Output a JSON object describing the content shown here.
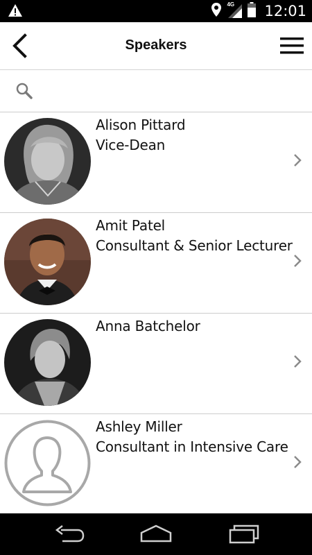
{
  "status_bar": {
    "time": "12:01",
    "network": "4G",
    "icons": [
      "warning-icon",
      "location-icon",
      "signal-icon",
      "battery-icon"
    ]
  },
  "header": {
    "title": "Speakers",
    "back_icon": "chevron-left-icon",
    "menu_icon": "hamburger-menu-icon"
  },
  "search": {
    "placeholder": "",
    "value": "",
    "icon": "search-icon"
  },
  "speakers": [
    {
      "name": "Alison Pittard",
      "role": "Vice-Dean",
      "avatar": "photo"
    },
    {
      "name": "Amit Patel",
      "role": "Consultant & Senior Lecturer",
      "avatar": "photo"
    },
    {
      "name": "Anna Batchelor",
      "role": "",
      "avatar": "photo"
    },
    {
      "name": "Ashley Miller",
      "role": "Consultant in Intensive Care",
      "avatar": "placeholder-silhouette"
    }
  ],
  "nav_bar": {
    "buttons": [
      "back-nav-icon",
      "home-nav-icon",
      "recents-nav-icon"
    ]
  },
  "colors": {
    "status_bar_bg": "#000000",
    "header_bg": "#ffffff",
    "divider": "#cccccc",
    "chevron": "#8a8a8a",
    "text": "#111111"
  }
}
